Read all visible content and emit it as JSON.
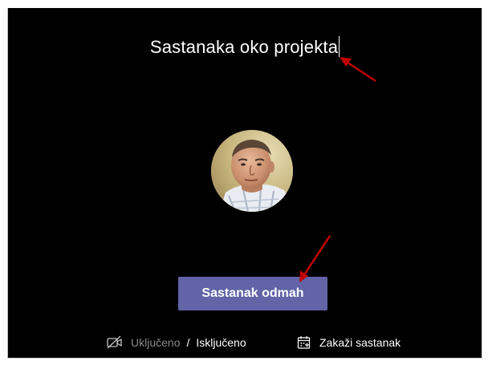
{
  "meeting": {
    "title": "Sastanaka oko projekta"
  },
  "actions": {
    "meet_now_label": "Sastanak odmah"
  },
  "video_toggle": {
    "icon": "video-off-icon",
    "on_label": "Uključeno",
    "separator": "/",
    "off_label": "Isključeno"
  },
  "schedule": {
    "icon": "calendar-add-icon",
    "label": "Zakaži sastanak"
  },
  "colors": {
    "background": "#000000",
    "primary_button": "#6264a7",
    "annotation_arrow": "#c00000",
    "inactive_text": "#8a8a8a"
  }
}
